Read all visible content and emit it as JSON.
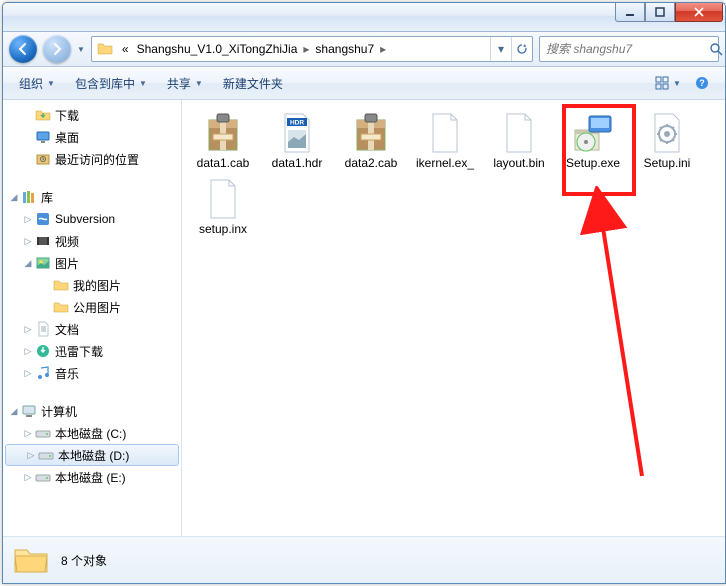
{
  "titlebar": {},
  "nav": {
    "path_prefix": "«",
    "crumb1": "Shangshu_V1.0_XiTongZhiJia",
    "crumb2": "shangshu7"
  },
  "search": {
    "placeholder": "搜索 shangshu7"
  },
  "toolbar": {
    "organize": "组织",
    "include": "包含到库中",
    "share": "共享",
    "newfolder": "新建文件夹"
  },
  "sidebar": {
    "downloads": "下载",
    "desktop": "桌面",
    "recent": "最近访问的位置",
    "libraries": "库",
    "subversion": "Subversion",
    "videos": "视频",
    "pictures": "图片",
    "mypictures": "我的图片",
    "publicpictures": "公用图片",
    "documents": "文档",
    "xunlei": "迅雷下载",
    "music": "音乐",
    "computer": "计算机",
    "drive_c": "本地磁盘 (C:)",
    "drive_d": "本地磁盘 (D:)",
    "drive_e": "本地磁盘 (E:)"
  },
  "files": {
    "f0": "data1.cab",
    "f1": "data1.hdr",
    "f2": "data2.cab",
    "f3": "ikernel.ex_",
    "f4": "layout.bin",
    "f5": "Setup.exe",
    "f6": "Setup.ini",
    "f7": "setup.inx"
  },
  "status": {
    "count": "8 个对象"
  }
}
